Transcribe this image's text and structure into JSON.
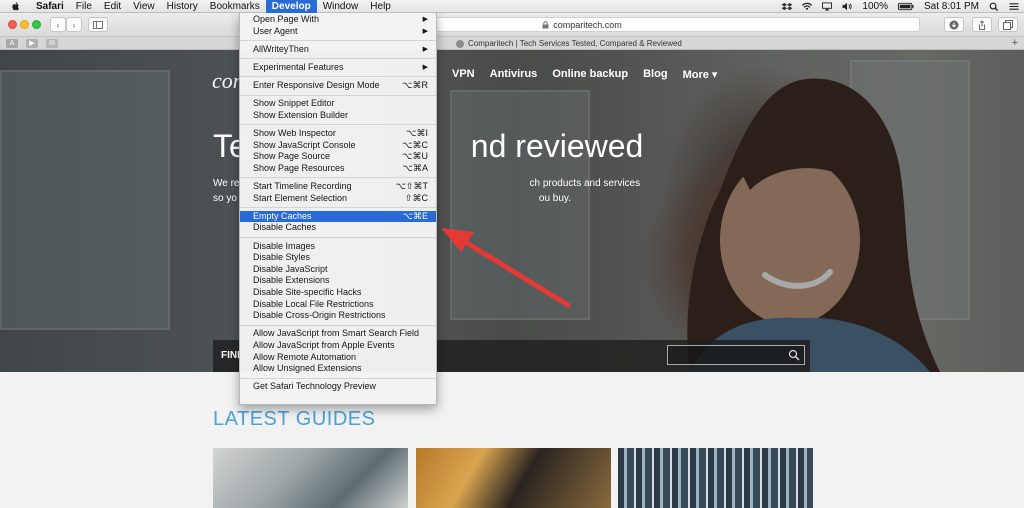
{
  "menubar": {
    "app": "Safari",
    "items": [
      "File",
      "Edit",
      "View",
      "History",
      "Bookmarks",
      "Develop",
      "Window",
      "Help"
    ],
    "active": "Develop",
    "battery": "100%",
    "clock": "Sat 8:01 PM"
  },
  "toolbar": {
    "url": "comparitech.com"
  },
  "tab": {
    "title": "Comparitech | Tech Services Tested, Compared & Reviewed"
  },
  "hero": {
    "logo": "compa",
    "nav": [
      "VPN",
      "Antivirus",
      "Online backup",
      "Blog",
      "More ▾"
    ],
    "headline_left": "Te",
    "headline_right": "nd reviewed",
    "sub1_left": "We re",
    "sub1_right": "ch products and services",
    "sub2_left": "so yo",
    "sub2_right": "ou buy.",
    "find_label": "FIND"
  },
  "latest_guides": "LATEST GUIDES",
  "develop_menu": {
    "groups": [
      [
        {
          "label": "Open Page With",
          "submenu": true
        },
        {
          "label": "User Agent",
          "submenu": true
        }
      ],
      [
        {
          "label": "AllWriteyThen",
          "submenu": true
        }
      ],
      [
        {
          "label": "Experimental Features",
          "submenu": true
        }
      ],
      [
        {
          "label": "Enter Responsive Design Mode",
          "shortcut": "⌥⌘R"
        }
      ],
      [
        {
          "label": "Show Snippet Editor"
        },
        {
          "label": "Show Extension Builder"
        }
      ],
      [
        {
          "label": "Show Web Inspector",
          "shortcut": "⌥⌘I"
        },
        {
          "label": "Show JavaScript Console",
          "shortcut": "⌥⌘C"
        },
        {
          "label": "Show Page Source",
          "shortcut": "⌥⌘U"
        },
        {
          "label": "Show Page Resources",
          "shortcut": "⌥⌘A"
        }
      ],
      [
        {
          "label": "Start Timeline Recording",
          "shortcut": "⌥⇧⌘T"
        },
        {
          "label": "Start Element Selection",
          "shortcut": "⇧⌘C"
        }
      ],
      [
        {
          "label": "Empty Caches",
          "shortcut": "⌥⌘E",
          "highlighted": true
        },
        {
          "label": "Disable Caches"
        }
      ],
      [
        {
          "label": "Disable Images"
        },
        {
          "label": "Disable Styles"
        },
        {
          "label": "Disable JavaScript"
        },
        {
          "label": "Disable Extensions"
        },
        {
          "label": "Disable Site-specific Hacks"
        },
        {
          "label": "Disable Local File Restrictions"
        },
        {
          "label": "Disable Cross-Origin Restrictions"
        }
      ],
      [
        {
          "label": "Allow JavaScript from Smart Search Field"
        },
        {
          "label": "Allow JavaScript from Apple Events"
        },
        {
          "label": "Allow Remote Automation"
        },
        {
          "label": "Allow Unsigned Extensions"
        }
      ],
      [
        {
          "label": "Get Safari Technology Preview"
        }
      ]
    ]
  },
  "colors": {
    "highlight": "#2a6ad6",
    "arrow": "#e53935",
    "accent_blue": "#4aa1d8"
  },
  "icons": {
    "apple": "apple-logo-icon",
    "search": "search-icon",
    "lock": "lock-icon"
  }
}
